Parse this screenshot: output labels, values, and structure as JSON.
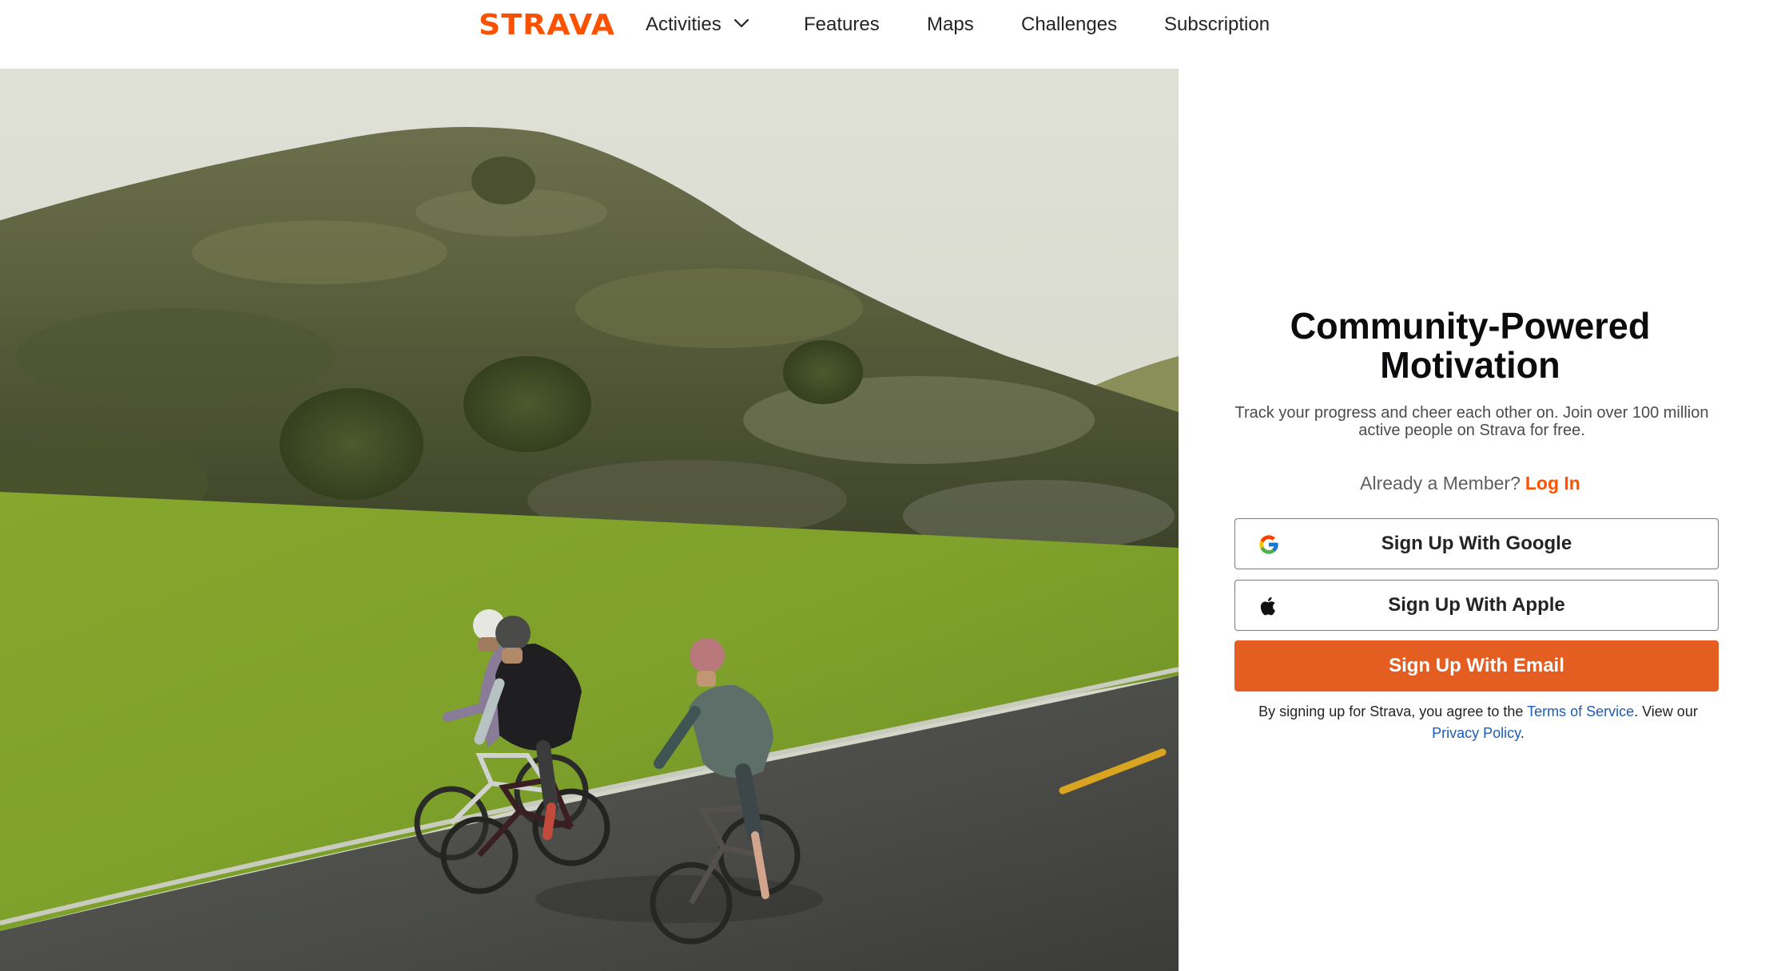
{
  "nav": {
    "logo": "STRAVA",
    "items": [
      {
        "label": "Activities",
        "has_dropdown": true
      },
      {
        "label": "Features"
      },
      {
        "label": "Maps"
      },
      {
        "label": "Challenges"
      },
      {
        "label": "Subscription"
      }
    ]
  },
  "hero": {
    "image": "cyclists-on-road-photo"
  },
  "signup": {
    "title_line1": "Community-Powered",
    "title_line2": "Motivation",
    "subtitle": "Track your progress and cheer each other on. Join over 100 million active people on Strava for free.",
    "member_prompt": "Already a Member?",
    "login_label": "Log In",
    "google_label": "Sign Up With Google",
    "apple_label": "Sign Up With Apple",
    "email_label": "Sign Up With Email",
    "legal_prefix": "By signing up for Strava, you agree to the",
    "terms_label": "Terms of Service",
    "legal_middle": ". View our",
    "privacy_label": "Privacy Policy",
    "legal_suffix": "."
  },
  "colors": {
    "brand_orange": "#fc5200",
    "email_button": "#e45d21",
    "link_blue": "#1d5bb8"
  },
  "icons": {
    "google": "google-icon",
    "apple": "apple-icon",
    "dropdown": "chevron-down-icon"
  }
}
